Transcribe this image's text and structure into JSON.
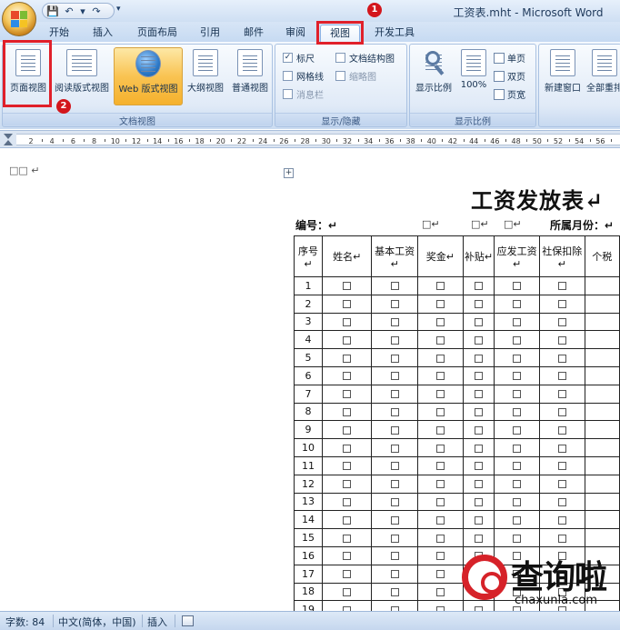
{
  "window": {
    "title": "工资表.mht - Microsoft Word"
  },
  "qat": {
    "save": "💾",
    "undo": "↶",
    "undo_drop": "▾",
    "redo": "↷",
    "customize": "▾"
  },
  "tabs": [
    "开始",
    "插入",
    "页面布局",
    "引用",
    "邮件",
    "审阅",
    "视图",
    "开发工具"
  ],
  "active_tab": "视图",
  "annotations": {
    "badge1": "1",
    "badge2": "2",
    "highlight_color": "#e0202a"
  },
  "ribbon": {
    "group_views": {
      "label": "文档视图",
      "buttons": [
        "页面视图",
        "阅读版式视图",
        "Web 版式视图",
        "大纲视图",
        "普通视图"
      ],
      "selected": "Web 版式视图"
    },
    "group_show": {
      "label": "显示/隐藏",
      "checks": [
        {
          "label": "标尺",
          "checked": true,
          "enabled": true
        },
        {
          "label": "文档结构图",
          "checked": false,
          "enabled": true
        },
        {
          "label": "网格线",
          "checked": false,
          "enabled": true
        },
        {
          "label": "缩略图",
          "checked": false,
          "enabled": false
        },
        {
          "label": "消息栏",
          "checked": false,
          "enabled": false
        }
      ]
    },
    "group_zoom": {
      "label": "显示比例",
      "zoom_label": "显示比例",
      "hundred_label": "100%",
      "single": "单页",
      "double": "双页",
      "width": "页宽"
    },
    "group_window": {
      "new_window": "新建窗口",
      "arrange_all": "全部重排"
    }
  },
  "ruler": {
    "numbers": [
      "2",
      "4",
      "6",
      "8",
      "10",
      "12",
      "14",
      "16",
      "18",
      "20",
      "22",
      "24",
      "26",
      "28",
      "30",
      "32",
      "34",
      "36",
      "38",
      "40",
      "42",
      "44",
      "46",
      "48",
      "50",
      "52",
      "54",
      "56"
    ]
  },
  "document": {
    "top_mark": "□□ ↵",
    "anchor": "+",
    "title": "工资发放表↵",
    "number_label": "编号：↵",
    "box_marks": [
      "□↵",
      "□↵",
      "□↵"
    ],
    "month_label": "所属月份：↵",
    "columns": [
      "序号↵",
      "姓名↵",
      "基本工资↵",
      "奖金↵",
      "补贴↵",
      "应发工资↵",
      "社保扣除↵",
      "个税"
    ],
    "rows": [
      "1",
      "2",
      "3",
      "4",
      "5",
      "6",
      "7",
      "8",
      "9",
      "10",
      "11",
      "12",
      "13",
      "14",
      "15",
      "16",
      "17",
      "18",
      "19"
    ]
  },
  "statusbar": {
    "words": "字数: 84",
    "lang": "中文(简体，中国)",
    "mode": "插入"
  },
  "watermark": {
    "text": "查询啦",
    "url": "chaxunla.com"
  }
}
